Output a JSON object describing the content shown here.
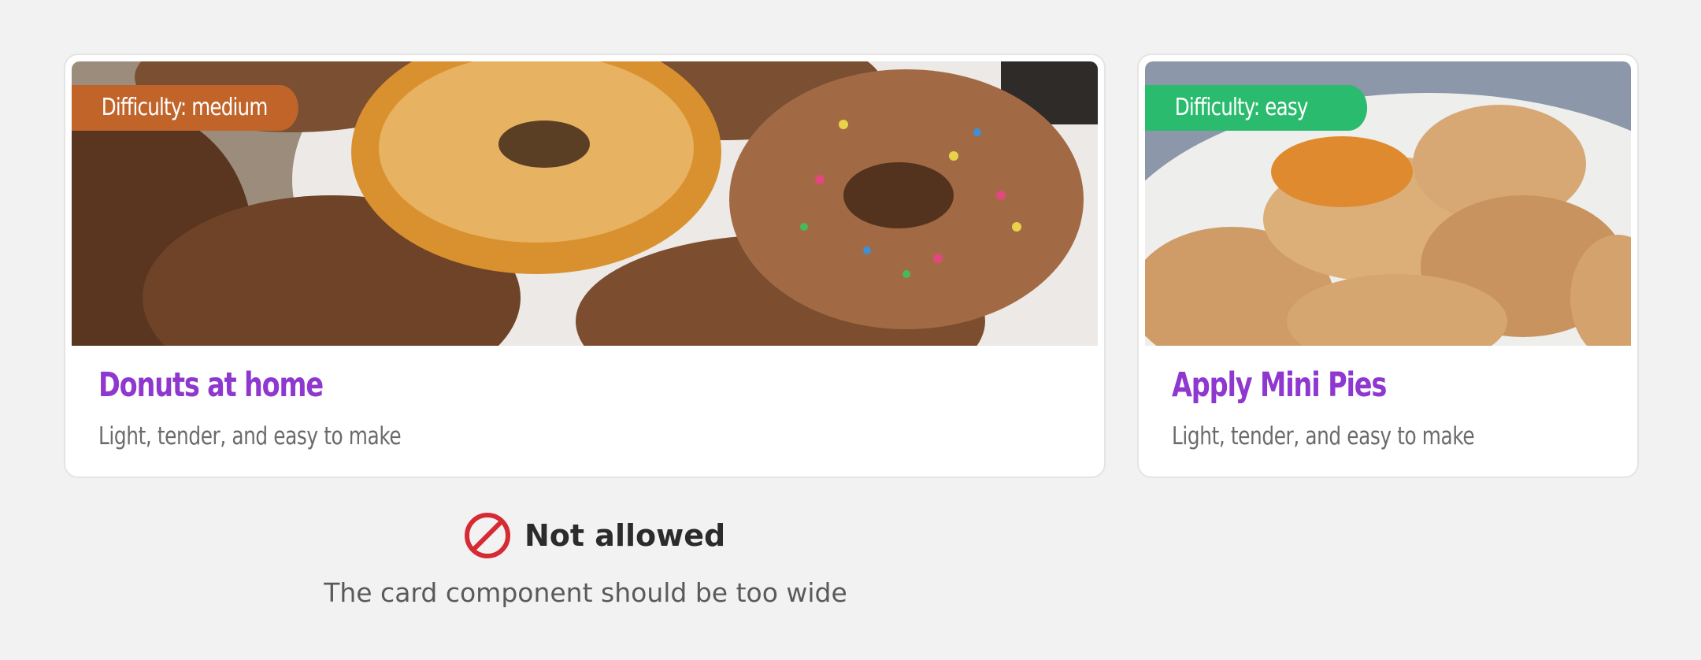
{
  "cards": [
    {
      "image": "donuts-photo",
      "badge": "Difficulty: medium",
      "badge_color": "#c1642a",
      "title": "Donuts at home",
      "subtitle": "Light, tender, and easy to make"
    },
    {
      "image": "mini-pies-photo",
      "badge": "Difficulty: easy",
      "badge_color": "#2bbb6e",
      "title": "Apply Mini Pies",
      "subtitle": "Light, tender, and easy to make"
    }
  ],
  "verdict": {
    "icon": "prohibited-icon",
    "icon_color": "#d62b35",
    "label": "Not allowed",
    "note": "The card component should be too wide"
  },
  "colors": {
    "background": "#f2f2f2",
    "title": "#8e38cf",
    "subtitle": "#6b6b6b"
  }
}
